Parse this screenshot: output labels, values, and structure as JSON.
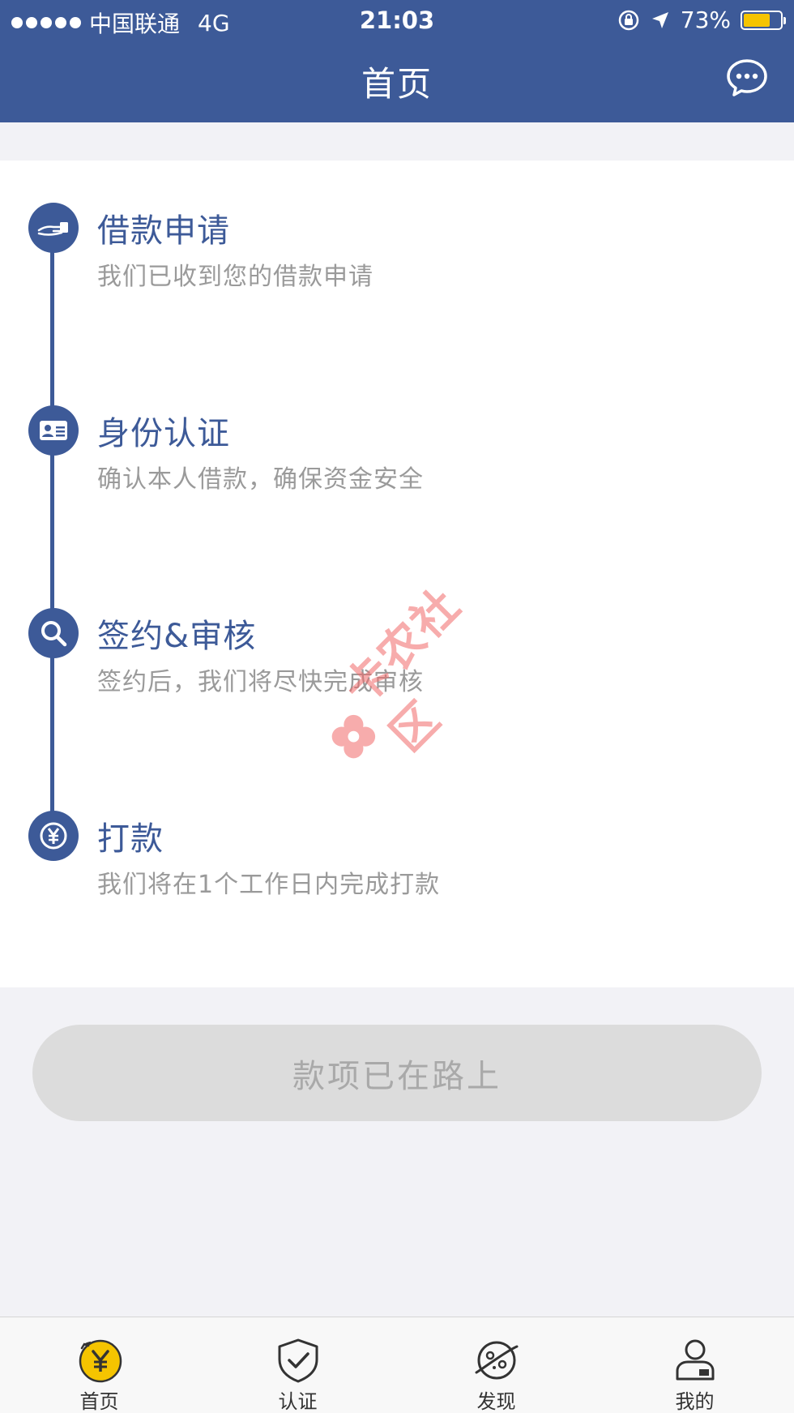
{
  "status_bar": {
    "carrier": "中国联通",
    "network": "4G",
    "time": "21:03",
    "battery": "73%",
    "battery_level": 0.73
  },
  "header": {
    "title": "首页",
    "chat_icon": "chat-bubble-icon"
  },
  "steps": [
    {
      "title": "借款申请",
      "desc": "我们已收到您的借款申请",
      "icon": "hand-money-icon"
    },
    {
      "title": "身份认证",
      "desc": "确认本人借款，确保资金安全",
      "icon": "id-card-icon"
    },
    {
      "title": "签约&审核",
      "desc": "签约后，我们将尽快完成审核",
      "icon": "search-icon"
    },
    {
      "title": "打款",
      "desc": "我们将在1个工作日内完成打款",
      "icon": "yen-coin-icon"
    }
  ],
  "watermark": {
    "text": "卡农社区"
  },
  "action_button": {
    "label": "款项已在路上"
  },
  "tabs": [
    {
      "label": "首页",
      "icon": "yen-home-icon",
      "active": true
    },
    {
      "label": "认证",
      "icon": "shield-check-icon",
      "active": false
    },
    {
      "label": "发现",
      "icon": "planet-icon",
      "active": false
    },
    {
      "label": "我的",
      "icon": "profile-icon",
      "active": false
    }
  ],
  "colors": {
    "primary": "#3d5a98",
    "accent_yellow": "#f5c400",
    "button_disabled": "#dcdcdc",
    "background": "#f2f2f6"
  }
}
